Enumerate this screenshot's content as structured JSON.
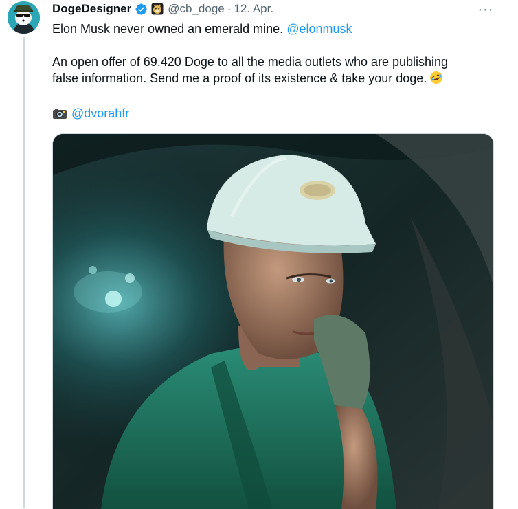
{
  "tweet": {
    "author_name": "DogeDesigner",
    "handle": "@cb_doge",
    "separator": "·",
    "date": "12. Apr.",
    "more_label": "···",
    "line1_text": "Elon Musk never owned an emerald mine.",
    "line1_mention": "@elonmusk",
    "line2": "An open offer of 69.420 Doge to all the media outlets who are publishing",
    "line3": "false information. Send me a proof of its existence & take your doge.",
    "credit_mention": "@dvorahfr"
  },
  "icons": {
    "verified": "verified-badge-icon",
    "doge": "doge-affiliate-icon",
    "laugh": "rolling-laughing-emoji",
    "camera": "camera-emoji",
    "more": "more-options-icon"
  },
  "colors": {
    "link": "#1d9bf0",
    "verified": "#1d9bf0",
    "secondary_text": "#536471",
    "thread_line": "#cfd9de"
  }
}
